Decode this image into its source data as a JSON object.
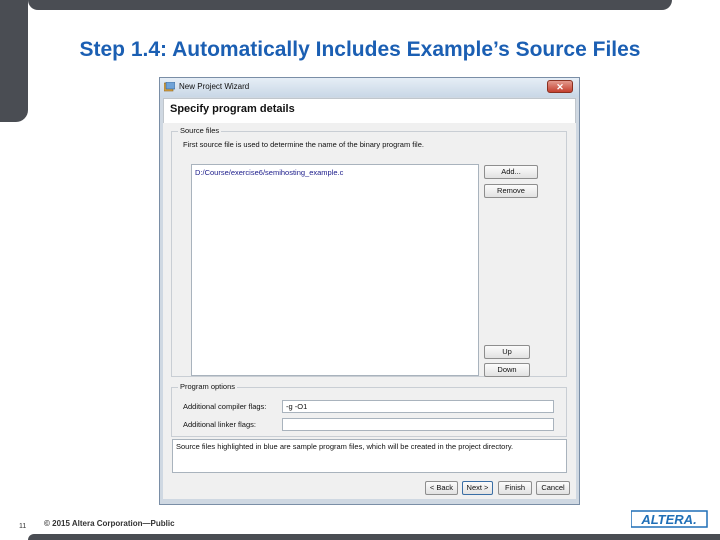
{
  "slide": {
    "title": "Step 1.4: Automatically Includes Example’s Source Files",
    "page_number": "11",
    "copyright": "© 2015 Altera Corporation—Public",
    "logo_text": "ALTERA."
  },
  "dialog": {
    "window_title": "New Project Wizard",
    "close_label": "✕",
    "header_title": "Specify program details",
    "source_files": {
      "legend": "Source files",
      "description": "First source file is used to determine the name of the binary program file.",
      "files": [
        "D:/Course/exercise6/semihosting_example.c"
      ],
      "add_label": "Add...",
      "remove_label": "Remove",
      "up_label": "Up",
      "down_label": "Down"
    },
    "program_options": {
      "legend": "Program options",
      "compiler_flags_label": "Additional compiler flags:",
      "compiler_flags_value": "-g -O1",
      "linker_flags_label": "Additional linker flags:",
      "linker_flags_value": ""
    },
    "info_text": "Source files highlighted in blue are sample program files, which will be created in the project directory.",
    "nav": {
      "back_label": "< Back",
      "next_label": "Next >",
      "finish_label": "Finish",
      "cancel_label": "Cancel"
    }
  },
  "colors": {
    "title_blue": "#1b5fb3",
    "chrome_gray": "#4a4d53",
    "logo_blue": "#1f6fb7",
    "sample_file_blue": "#1a1a8a"
  }
}
